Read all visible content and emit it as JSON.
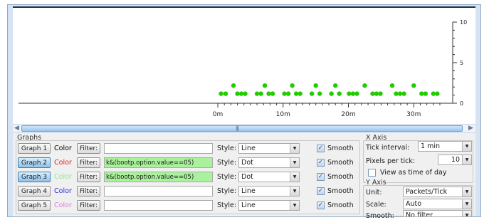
{
  "plot": {
    "y_ticks": [
      "10",
      "5",
      "0"
    ],
    "x_ticks": [
      "0m",
      "10m",
      "20m",
      "30m"
    ],
    "series_color": "#22cc00",
    "axis_color": "#333333"
  },
  "chart_data": {
    "type": "scatter",
    "title": "",
    "xlabel": "",
    "ylabel": "",
    "xlim": [
      0,
      34
    ],
    "ylim": [
      0,
      10
    ],
    "x_tick_labels": [
      "0m",
      "10m",
      "20m",
      "30m"
    ],
    "y_tick_labels": [
      "0",
      "5",
      "10"
    ],
    "series": [
      {
        "color": "#22cc00",
        "points": [
          [
            0.5,
            1
          ],
          [
            1.2,
            1
          ],
          [
            2.4,
            2
          ],
          [
            3.0,
            1
          ],
          [
            3.6,
            1
          ],
          [
            4.2,
            1
          ],
          [
            6.0,
            1
          ],
          [
            6.6,
            1
          ],
          [
            7.2,
            2
          ],
          [
            7.8,
            1
          ],
          [
            8.4,
            1
          ],
          [
            10.2,
            1
          ],
          [
            10.8,
            1
          ],
          [
            11.4,
            2
          ],
          [
            12.0,
            1
          ],
          [
            12.6,
            1
          ],
          [
            14.4,
            1
          ],
          [
            15.0,
            2
          ],
          [
            15.6,
            1
          ],
          [
            17.4,
            1
          ],
          [
            18.0,
            2
          ],
          [
            18.6,
            1
          ],
          [
            20.1,
            1
          ],
          [
            20.7,
            1
          ],
          [
            21.3,
            1
          ],
          [
            22.5,
            2
          ],
          [
            23.7,
            1
          ],
          [
            24.3,
            1
          ],
          [
            24.9,
            1
          ],
          [
            26.7,
            2
          ],
          [
            27.3,
            1
          ],
          [
            27.9,
            1
          ],
          [
            28.5,
            1
          ],
          [
            30.0,
            2
          ],
          [
            31.2,
            1
          ],
          [
            31.8,
            1
          ],
          [
            33.0,
            1
          ],
          [
            33.6,
            1
          ]
        ]
      }
    ]
  },
  "graphs": {
    "title": "Graphs",
    "color_label": "Color",
    "filter_label": "Filter:",
    "style_label": "Style:",
    "smooth_label": "Smooth",
    "rows": [
      {
        "button": "Graph 1",
        "color": "#000000",
        "filter": "",
        "style": "Line",
        "smooth": true,
        "active": false
      },
      {
        "button": "Graph 2",
        "color": "#e02020",
        "filter": "k&(bootp.option.value==05)",
        "style": "Dot",
        "smooth": true,
        "active": true
      },
      {
        "button": "Graph 3",
        "color": "#8ee88e",
        "filter": "k&(bootp.option.value==05)",
        "style": "Dot",
        "smooth": true,
        "active": true
      },
      {
        "button": "Graph 4",
        "color": "#2b2bd8",
        "filter": "",
        "style": "Line",
        "smooth": true,
        "active": false
      },
      {
        "button": "Graph 5",
        "color": "#d77be0",
        "filter": "",
        "style": "Line",
        "smooth": true,
        "active": false
      }
    ]
  },
  "xaxis": {
    "title": "X Axis",
    "tick_interval_label": "Tick interval:",
    "tick_interval_value": "1 min",
    "pixels_per_tick_label": "Pixels per tick:",
    "pixels_per_tick_value": "10",
    "view_time_label": "View as time of day",
    "view_time_checked": false
  },
  "yaxis": {
    "title": "Y Axis",
    "unit_label": "Unit:",
    "unit_value": "Packets/Tick",
    "scale_label": "Scale:",
    "scale_value": "Auto",
    "smooth_label": "Smooth:",
    "smooth_value": "No filter"
  },
  "scrollbar": {
    "grip": "|||"
  }
}
